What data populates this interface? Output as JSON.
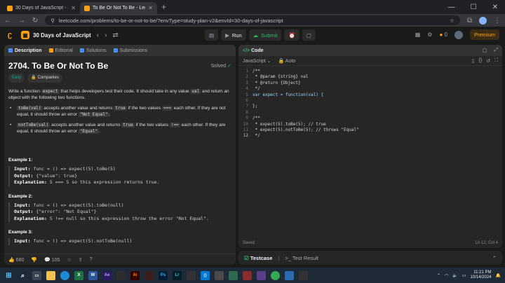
{
  "browser": {
    "tabs": [
      {
        "title": "30 Days of JavaScript - Study P",
        "active": false,
        "fav_color": "#ffa116"
      },
      {
        "title": "To Be Or Not To Be - LeetCode",
        "active": true,
        "fav_color": "#ffa116"
      }
    ],
    "url": "leetcode.com/problems/to-be-or-not-to-be/?envType=study-plan-v2&envId=30-days-of-javascript"
  },
  "header": {
    "study_plan": "30 Days of JavaScript",
    "run": "Run",
    "submit": "Submit",
    "coins": "0",
    "premium": "Premium"
  },
  "left_tabs": [
    "Description",
    "Editorial",
    "Solutions",
    "Submissions"
  ],
  "problem": {
    "title": "2704. To Be Or Not To Be",
    "solved": "Solved",
    "difficulty": "Easy",
    "companies": "Companies",
    "intro_a": "Write a function ",
    "intro_code1": "expect",
    "intro_b": " that helps developers test their code. It should take in any value ",
    "intro_code2": "val",
    "intro_c": " and return an object with the following two functions.",
    "b1_code": "toBe(val)",
    "b1_a": " accepts another value and returns ",
    "b1_true": "true",
    "b1_b": " if the two values ",
    "b1_op": "===",
    "b1_c": " each other. If they are not equal, it should throw an error ",
    "b1_err": "\"Not Equal\"",
    "b2_code": "notToBe(val)",
    "b2_a": " accepts another value and returns ",
    "b2_true": "true",
    "b2_b": " if the two values ",
    "b2_op": "!==",
    "b2_c": " each other. If they are equal, it should throw an error ",
    "b2_err": "\"Equal\"",
    "examples": [
      {
        "h": "Example 1:",
        "input": "func = () => expect(5).toBe(5)",
        "output": "{\"value\": true}",
        "expl": "5 === 5 so this expression returns true."
      },
      {
        "h": "Example 2:",
        "input": "func = () => expect(5).toBe(null)",
        "output": "{\"error\": \"Not Equal\"}",
        "expl": "5 !== null so this expression throw the error \"Not Equal\"."
      },
      {
        "h": "Example 3:",
        "input": "func = () => expect(5).notToBe(null)"
      }
    ],
    "likes": "680",
    "comments": "105"
  },
  "editor": {
    "tab": "Code",
    "language": "JavaScript",
    "auto": "Auto",
    "saved": "Saved",
    "cursor": "Ln 12, Col 4",
    "bottom_tab1": "Testcase",
    "bottom_tab2": "Test Result"
  },
  "code_lines": [
    {
      "n": "1",
      "t": "/**"
    },
    {
      "n": "2",
      "t": " * @param {string} val"
    },
    {
      "n": "3",
      "t": " * @return {Object}"
    },
    {
      "n": "4",
      "t": " */"
    },
    {
      "n": "5",
      "t": "var expect = function(val) {"
    },
    {
      "n": "6",
      "t": ""
    },
    {
      "n": "7",
      "t": "};"
    },
    {
      "n": "8",
      "t": ""
    },
    {
      "n": "9",
      "t": "/**"
    },
    {
      "n": "10",
      "t": " * expect(5).toBe(5); // true"
    },
    {
      "n": "11",
      "t": " * expect(5).notToBe(5); // throws \"Equal\""
    },
    {
      "n": "12",
      "t": " */"
    }
  ],
  "taskbar": {
    "time": "11:21 PM",
    "date": "10/14/2024"
  }
}
